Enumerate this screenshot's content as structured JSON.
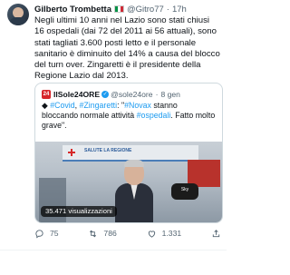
{
  "tweet": {
    "author_name": "Gilberto Trombetta",
    "handle": "@Gitro77",
    "separator": "·",
    "age": "17h",
    "text": "Negli ultimi 10 anni nel Lazio sono stati chiusi 16 ospedali (dai 72 del 2011 ai 56 attuali), sono stati tagliati 3.600 posti letto e il personale sanitario è diminuito del 14% a causa del blocco del turn over. Zingaretti è il presidente della Regione Lazio dal 2013."
  },
  "quote": {
    "account_name": "IlSole24ORE",
    "logo_text": "24",
    "verified_mark": "✓",
    "handle": "@sole24ore",
    "separator": "·",
    "date": "8 gen",
    "text_prefix": "◆ ",
    "tag_covid": "#Covid",
    "tag_zingaretti": "#Zingaretti",
    "text_mid": ": \"",
    "tag_novax": "#Novax",
    "text_mid2": " stanno bloccando normale attività ",
    "tag_ospedali": "#ospedali",
    "text_end": ". Fatto molto grave\".",
    "video_views": "35.471 visualizzazioni",
    "video_banner": "SALUTE LA REGIONE",
    "video_mic_label": "Sky"
  },
  "actions": {
    "reply_count": "75",
    "retweet_count": "786",
    "like_count": "1.331"
  },
  "icons": {
    "reply": "reply-icon",
    "retweet": "retweet-icon",
    "like": "heart-icon",
    "share": "share-icon"
  },
  "colors": {
    "accent": "#1d9bf0",
    "muted": "#536471",
    "brand_red": "#d6252a"
  }
}
